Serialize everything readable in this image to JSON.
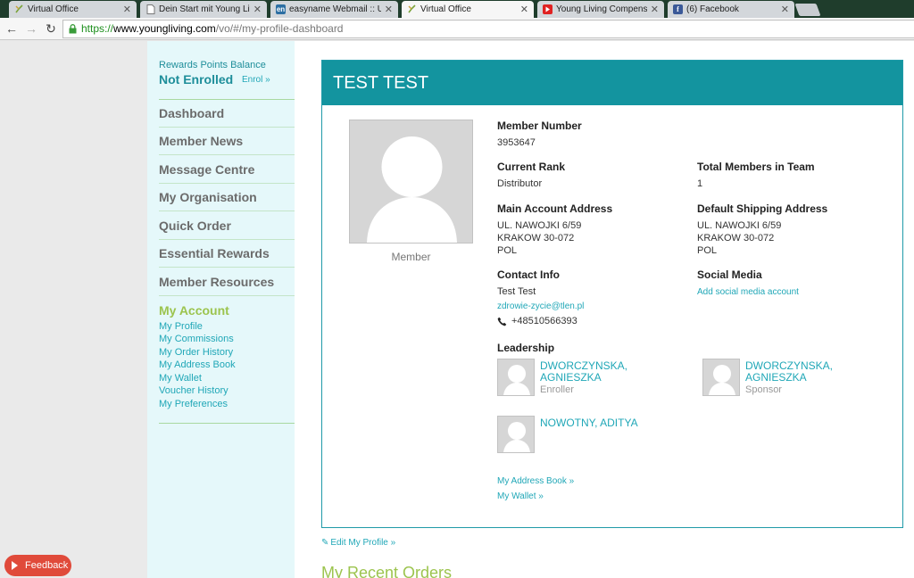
{
  "browser": {
    "tabs": [
      {
        "title": "Virtual Office",
        "icon": "young-living-icon"
      },
      {
        "title": "Dein Start mit Young Living",
        "icon": "document-icon"
      },
      {
        "title": "easyname Webmail :: Utw",
        "icon": "easyname-icon"
      },
      {
        "title": "Virtual Office",
        "icon": "young-living-icon",
        "active": true
      },
      {
        "title": "Young Living Compensation",
        "icon": "youtube-icon"
      },
      {
        "title": "(6) Facebook",
        "icon": "facebook-icon"
      }
    ],
    "url": {
      "protocol": "https://",
      "host": "www.youngliving.com",
      "path": "/vo/#/my-profile-dashboard"
    }
  },
  "sidebar": {
    "rewards_label": "Rewards Points Balance",
    "rewards_status": "Not Enrolled",
    "enrol_link": "Enrol »",
    "items": [
      "Dashboard",
      "Member News",
      "Message Centre",
      "My Organisation",
      "Quick Order",
      "Essential Rewards",
      "Member Resources"
    ],
    "my_account": "My Account",
    "sub_items": [
      "My Profile",
      "My Commissions",
      "My Order History",
      "My Address Book",
      "My Wallet",
      "Voucher History",
      "My Preferences"
    ]
  },
  "profile": {
    "name": "TEST TEST",
    "avatar_caption": "Member",
    "member_number_label": "Member Number",
    "member_number": "3953647",
    "current_rank_label": "Current Rank",
    "current_rank": "Distributor",
    "total_members_label": "Total Members in Team",
    "total_members": "1",
    "main_address_label": "Main Account Address",
    "main_address": [
      "UL. NAWOJKI 6/59",
      "KRAKOW 30-072",
      "POL"
    ],
    "shipping_address_label": "Default Shipping Address",
    "shipping_address": [
      "UL. NAWOJKI 6/59",
      "KRAKOW 30-072",
      "POL"
    ],
    "contact_label": "Contact Info",
    "contact_name": "Test Test",
    "contact_email": "zdrowie-zycie@tlen.pl",
    "contact_phone": "+48510566393",
    "social_label": "Social Media",
    "social_link": "Add social media account",
    "leadership_label": "Leadership",
    "leaders": [
      {
        "name_line1": "DWORCZYNSKA,",
        "name_line2": "AGNIESZKA",
        "role": "Enroller"
      },
      {
        "name_line1": "DWORCZYNSKA,",
        "name_line2": "AGNIESZKA",
        "role": "Sponsor"
      },
      {
        "name_line1": "NOWOTNY, ADITYA",
        "name_line2": "",
        "role": ""
      }
    ],
    "address_book_link": "My Address Book »",
    "wallet_link": "My Wallet »"
  },
  "edit_profile_link": "Edit My Profile »",
  "recent_orders_title": "My Recent Orders",
  "feedback_label": "Feedback",
  "colors": {
    "teal": "#13949f",
    "link": "#20a7b7",
    "green": "#9cc44e",
    "sidebar_bg": "#e5f8fa",
    "feedback": "#e04a3a"
  }
}
